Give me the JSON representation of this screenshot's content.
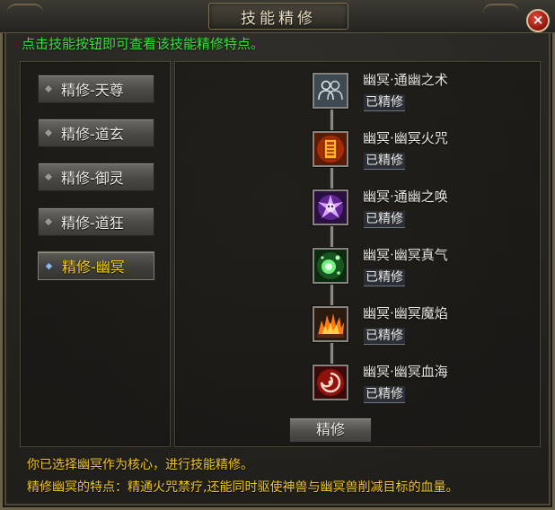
{
  "window": {
    "title": "技能精修",
    "close_label": "×"
  },
  "hint": "点击技能按钮即可查看该技能精修特点。",
  "tabs": [
    {
      "label": "精修-天尊",
      "active": false
    },
    {
      "label": "精修-道玄",
      "active": false
    },
    {
      "label": "精修-御灵",
      "active": false
    },
    {
      "label": "精修-道狂",
      "active": false
    },
    {
      "label": "精修-幽冥",
      "active": true
    }
  ],
  "skills": [
    {
      "name": "幽冥·通幽之术",
      "status": "已精修",
      "icon": "twin-figures-icon"
    },
    {
      "name": "幽冥·幽冥火咒",
      "status": "已精修",
      "icon": "fire-scroll-icon"
    },
    {
      "name": "幽冥·通幽之唤",
      "status": "已精修",
      "icon": "purple-skull-icon"
    },
    {
      "name": "幽冥·幽冥真气",
      "status": "已精修",
      "icon": "green-orb-icon"
    },
    {
      "name": "幽冥·幽冥魔焰",
      "status": "已精修",
      "icon": "flame-burst-icon"
    },
    {
      "name": "幽冥·幽冥血海",
      "status": "已精修",
      "icon": "blood-vortex-icon"
    }
  ],
  "refine_button": "精修",
  "description": {
    "line1": "你已选择幽冥作为核心，进行技能精修。",
    "line2": "精修幽冥的特点：精通火咒禁疗,还能同时驱使神兽与幽冥兽削减目标的血量。"
  },
  "colors": {
    "hint": "#3be23b",
    "active_tab": "#f2cd1e",
    "description": "#f2c623",
    "frame_border": "#6b6048"
  }
}
